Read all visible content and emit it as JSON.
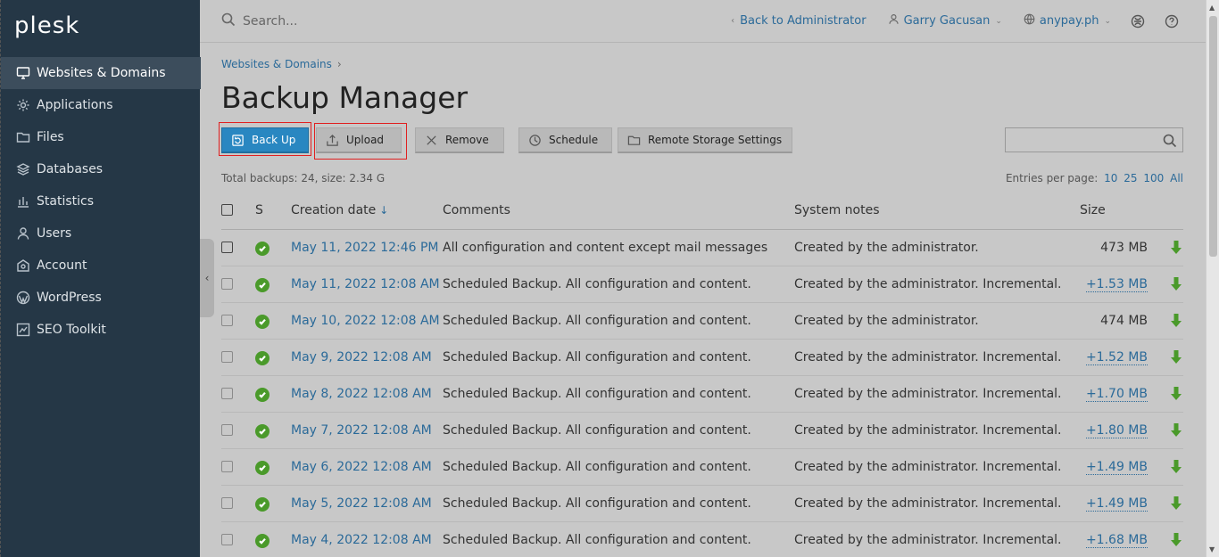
{
  "sidebar": {
    "logo": "plesk",
    "items": [
      {
        "label": "Websites & Domains",
        "icon": "monitor-icon",
        "active": true
      },
      {
        "label": "Applications",
        "icon": "gear-icon",
        "active": false
      },
      {
        "label": "Files",
        "icon": "folder-icon",
        "active": false
      },
      {
        "label": "Databases",
        "icon": "database-icon",
        "active": false
      },
      {
        "label": "Statistics",
        "icon": "bar-chart-icon",
        "active": false
      },
      {
        "label": "Users",
        "icon": "user-icon",
        "active": false
      },
      {
        "label": "Account",
        "icon": "account-icon",
        "active": false
      },
      {
        "label": "WordPress",
        "icon": "wordpress-icon",
        "active": false
      },
      {
        "label": "SEO Toolkit",
        "icon": "seo-icon",
        "active": false
      }
    ]
  },
  "topbar": {
    "search_placeholder": "Search...",
    "back_link": "Back to Administrator",
    "user": "Garry Gacusan",
    "domain": "anypay.ph"
  },
  "breadcrumb": {
    "item": "Websites & Domains"
  },
  "page": {
    "title": "Backup Manager"
  },
  "toolbar": {
    "backup": "Back Up",
    "upload": "Upload",
    "remove": "Remove",
    "schedule": "Schedule",
    "remote": "Remote Storage Settings"
  },
  "info": {
    "total": "Total backups: 24, size: 2.34 G",
    "entries_label": "Entries per page:",
    "entries_10": "10",
    "entries_25": "25",
    "entries_100": "100",
    "entries_all": "All"
  },
  "table": {
    "headers": {
      "s": "S",
      "date": "Creation date",
      "comments": "Comments",
      "notes": "System notes",
      "size": "Size"
    },
    "rows": [
      {
        "date": "May 11, 2022 12:46 PM",
        "comment": "All configuration and content except mail messages",
        "notes": "Created by the administrator.",
        "size": "473 MB",
        "incremental": false
      },
      {
        "date": "May 11, 2022 12:08 AM",
        "comment": "Scheduled Backup. All configuration and content.",
        "notes": "Created by the administrator. Incremental.",
        "size": "+1.53 MB",
        "incremental": true
      },
      {
        "date": "May 10, 2022 12:08 AM",
        "comment": "Scheduled Backup. All configuration and content.",
        "notes": "Created by the administrator.",
        "size": "474 MB",
        "incremental": false
      },
      {
        "date": "May 9, 2022 12:08 AM",
        "comment": "Scheduled Backup. All configuration and content.",
        "notes": "Created by the administrator. Incremental.",
        "size": "+1.52 MB",
        "incremental": true
      },
      {
        "date": "May 8, 2022 12:08 AM",
        "comment": "Scheduled Backup. All configuration and content.",
        "notes": "Created by the administrator. Incremental.",
        "size": "+1.70 MB",
        "incremental": true
      },
      {
        "date": "May 7, 2022 12:08 AM",
        "comment": "Scheduled Backup. All configuration and content.",
        "notes": "Created by the administrator. Incremental.",
        "size": "+1.80 MB",
        "incremental": true
      },
      {
        "date": "May 6, 2022 12:08 AM",
        "comment": "Scheduled Backup. All configuration and content.",
        "notes": "Created by the administrator. Incremental.",
        "size": "+1.49 MB",
        "incremental": true
      },
      {
        "date": "May 5, 2022 12:08 AM",
        "comment": "Scheduled Backup. All configuration and content.",
        "notes": "Created by the administrator. Incremental.",
        "size": "+1.49 MB",
        "incremental": true
      },
      {
        "date": "May 4, 2022 12:08 AM",
        "comment": "Scheduled Backup. All configuration and content.",
        "notes": "Created by the administrator. Incremental.",
        "size": "+1.68 MB",
        "incremental": true
      }
    ]
  },
  "colors": {
    "sidebar_bg": "#253746",
    "accent": "#2987c1",
    "link": "#2b6a99",
    "success": "#4a9a2a",
    "highlight": "#e02020"
  }
}
